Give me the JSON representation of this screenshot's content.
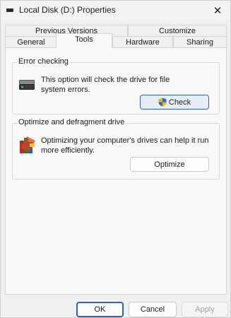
{
  "window": {
    "title": "Local Disk (D:) Properties",
    "close_glyph": "✕"
  },
  "tabs": {
    "row1": [
      {
        "label": "Previous Versions"
      },
      {
        "label": "Customize"
      }
    ],
    "row2": [
      {
        "label": "General"
      },
      {
        "label": "Tools",
        "active": true
      },
      {
        "label": "Hardware"
      },
      {
        "label": "Sharing"
      }
    ]
  },
  "error_checking": {
    "legend": "Error checking",
    "description_line1": "This option will check the drive for file",
    "description_line2": "system errors.",
    "button": "Check",
    "icon": "drive-icon",
    "button_icon": "uac-shield-icon"
  },
  "optimize": {
    "legend": "Optimize and defragment drive",
    "description_line1": "Optimizing your computer's drives can help it run",
    "description_line2": "more efficiently.",
    "button": "Optimize",
    "icon": "defrag-icon"
  },
  "footer": {
    "ok": "OK",
    "cancel": "Cancel",
    "apply": "Apply"
  },
  "colors": {
    "accent": "#2c62c4",
    "window_bg": "#f0f0f0",
    "panel_bg": "#f9f9f9"
  }
}
